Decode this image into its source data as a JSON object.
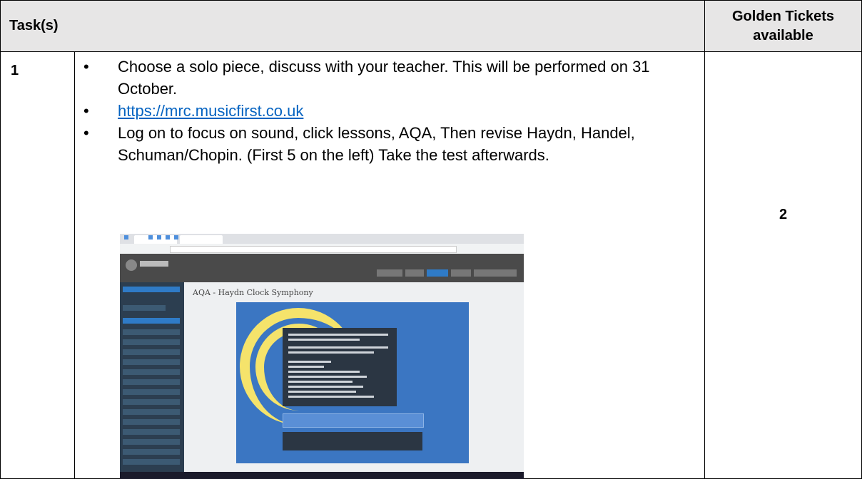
{
  "header": {
    "task_label": "Task(s)",
    "golden_label_line1": "Golden Tickets",
    "golden_label_line2": "available"
  },
  "row": {
    "number": "1",
    "bullets": [
      "Choose a solo piece, discuss with your teacher.  This will be performed on 31 October.",
      "https://mrc.musicfirst.co.uk",
      "Log on to focus on sound, click lessons, AQA, Then revise Haydn, Handel, Schuman/Chopin. (First 5 on the left) Take the test afterwards."
    ],
    "tickets": "2"
  },
  "screenshot": {
    "lesson_title": "AQA - Haydn Clock Symphony",
    "accent_blue": "#3b76c2",
    "accent_yellow": "#f5e36b"
  }
}
